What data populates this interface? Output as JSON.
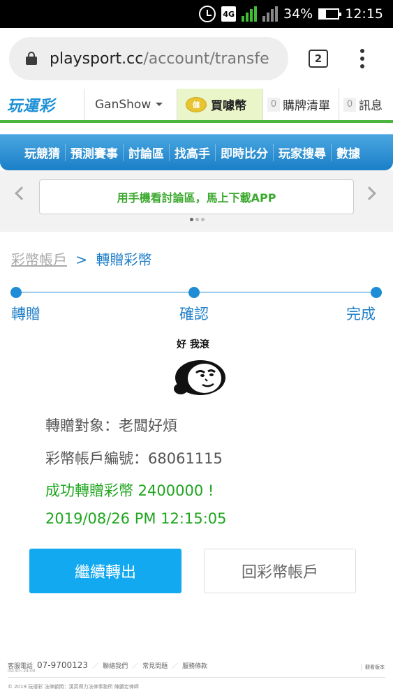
{
  "status_bar": {
    "network": "4G",
    "battery": "34%",
    "time": "12:15"
  },
  "browser": {
    "url_host": "playsport.cc",
    "url_path": "/account/transfe",
    "tab_count": "2"
  },
  "site_header": {
    "logo": "玩運彩",
    "username": "GanShow",
    "buy_coin_label": "買噱幣",
    "coin_badge": "儲",
    "purchase_list": {
      "count": "0",
      "label": "購牌清單"
    },
    "messages": {
      "count": "0",
      "label": "訊息"
    }
  },
  "nav": {
    "items": [
      "玩競猜",
      "預測賽事",
      "討論區",
      "找高手",
      "即時比分",
      "玩家搜尋",
      "數據"
    ]
  },
  "banner": {
    "text": "用手機看討論區，馬上下載APP"
  },
  "breadcrumb": {
    "parent": "彩幣帳戶",
    "separator": ">",
    "current": "轉贈彩幣"
  },
  "steps": {
    "labels": [
      "轉贈",
      "確認",
      "完成"
    ]
  },
  "meme": {
    "caption": "好 我滾"
  },
  "result": {
    "recipient": "轉贈對象：老闆好煩",
    "account": "彩幣帳戶編號：68061115",
    "success": "成功轉贈彩幣 2400000 !",
    "timestamp": "2019/08/26 PM 12:15:05"
  },
  "buttons": {
    "continue": "繼續轉出",
    "back": "回彩幣帳戶"
  },
  "footer": {
    "service_label": "客服電話",
    "phone": "07-9700123",
    "hours": "09:30~24:00",
    "links": [
      "聯絡我們",
      "常見問題",
      "服務條款"
    ],
    "right_text": "觀看版本",
    "copyright": "© 2019 玩運彩 法律顧問：漢英得力法律事務所 陳鵬宏律師"
  },
  "colors": {
    "brand_blue": "#1f8dd6",
    "success_green": "#1ea51e",
    "button_blue": "#13a9f0",
    "accent_green": "#4bb53f"
  }
}
